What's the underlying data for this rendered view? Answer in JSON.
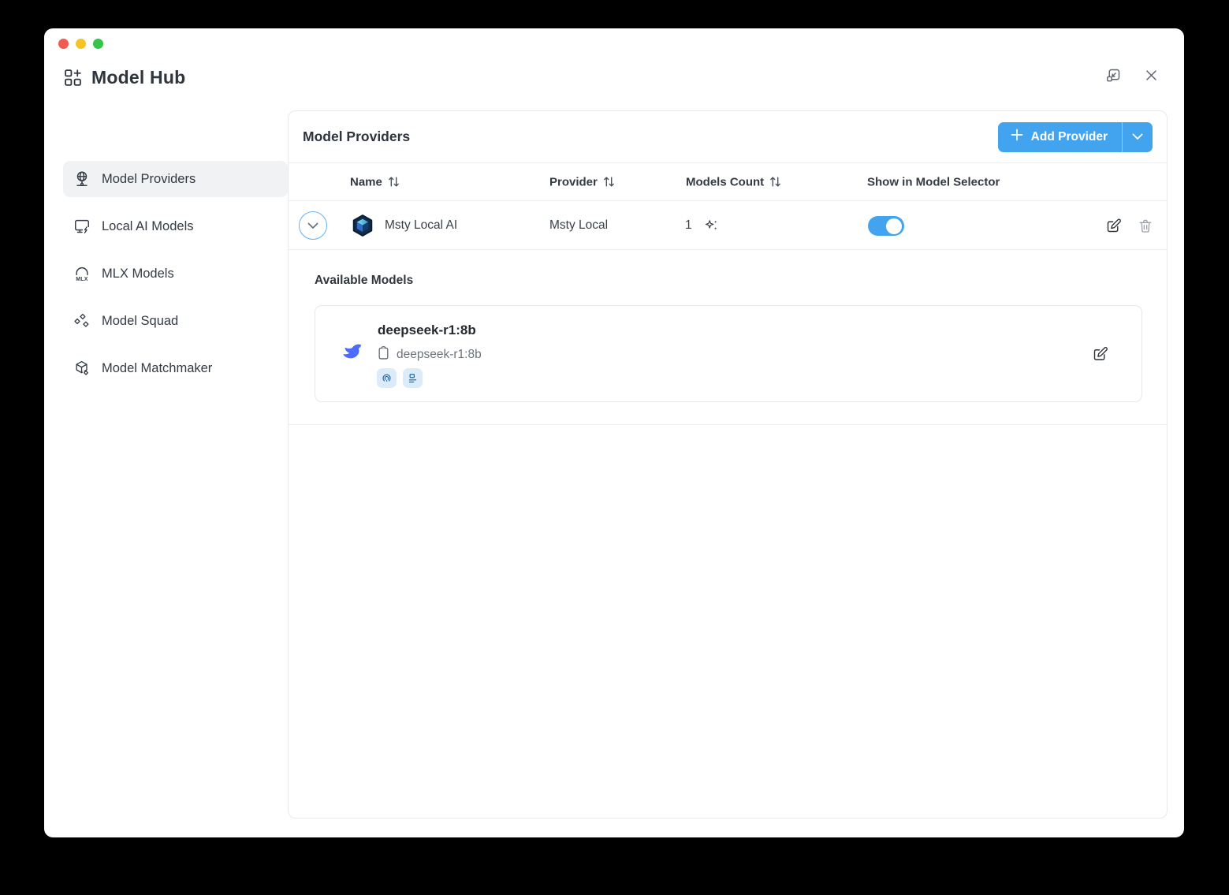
{
  "window": {
    "title": "Model Hub"
  },
  "sidebar": {
    "items": [
      {
        "label": "Model Providers",
        "icon": "globe-network-icon",
        "selected": true
      },
      {
        "label": "Local AI Models",
        "icon": "monitor-bolt-icon",
        "selected": false
      },
      {
        "label": "MLX Models",
        "icon": "mlx-icon",
        "selected": false
      },
      {
        "label": "Model Squad",
        "icon": "diamonds-icon",
        "selected": false
      },
      {
        "label": "Model Matchmaker",
        "icon": "cube-diamond-icon",
        "selected": false
      }
    ]
  },
  "main": {
    "header": {
      "title": "Model Providers",
      "add_button": {
        "label": "Add Provider"
      }
    },
    "table": {
      "headers": [
        {
          "label": "Name",
          "sortable": true
        },
        {
          "label": "Provider",
          "sortable": true
        },
        {
          "label": "Models Count",
          "sortable": true
        },
        {
          "label": "Show in Model Selector",
          "sortable": false
        }
      ],
      "rows": [
        {
          "name": "Msty Local AI",
          "provider": "Msty Local",
          "models_count": "1",
          "show_in_selector": true
        }
      ]
    },
    "available_models": {
      "heading": "Available Models",
      "models": [
        {
          "title": "deepseek-r1:8b",
          "model_id": "deepseek-r1:8b",
          "badges": [
            "broadcast-waves-icon",
            "form-lines-icon"
          ]
        }
      ]
    }
  },
  "colors": {
    "accent_blue": "#42a4ee",
    "toggle_on": "#42a4ee",
    "deepseek_logo": "#4d6bfe",
    "badge_bg": "#dcebfa",
    "badge_icon": "#1d5f93",
    "traffic_red": "#f15c51",
    "traffic_yellow": "#f5c327",
    "traffic_green": "#35c649"
  }
}
